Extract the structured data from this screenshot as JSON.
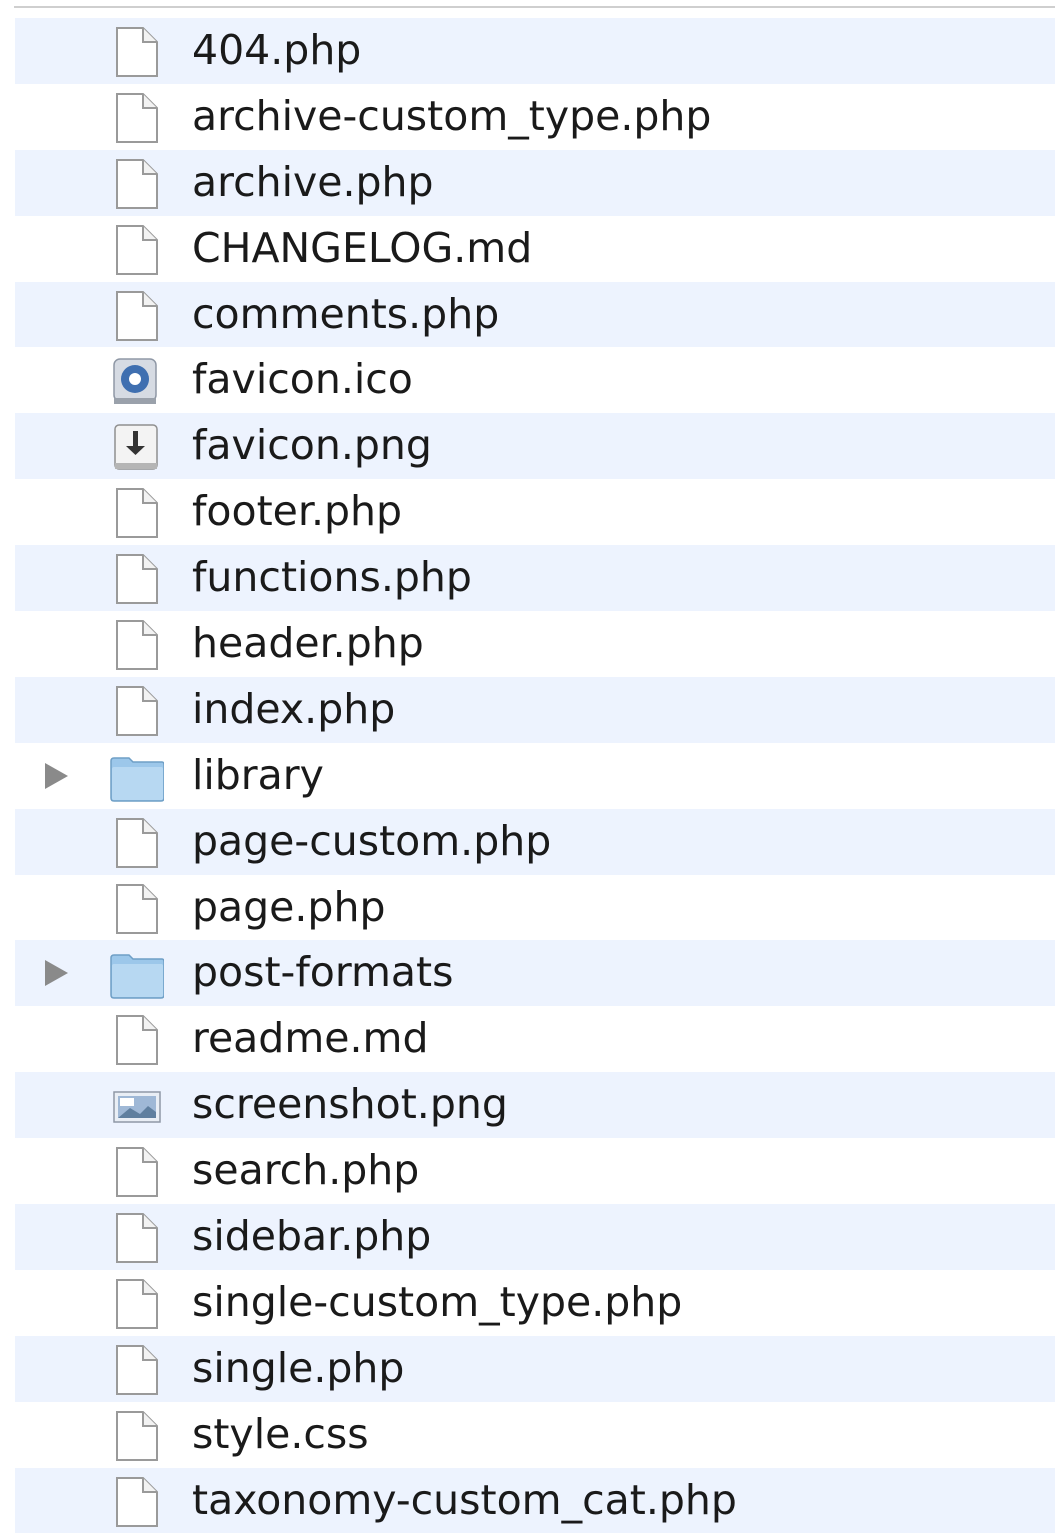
{
  "files": [
    {
      "name": "404.php",
      "icon": "document-icon"
    },
    {
      "name": "archive-custom_type.php",
      "icon": "document-icon"
    },
    {
      "name": "archive.php",
      "icon": "document-icon"
    },
    {
      "name": "CHANGELOG.md",
      "icon": "document-icon"
    },
    {
      "name": "comments.php",
      "icon": "document-icon"
    },
    {
      "name": "favicon.ico",
      "icon": "ico-file-icon"
    },
    {
      "name": "favicon.png",
      "icon": "png-file-icon"
    },
    {
      "name": "footer.php",
      "icon": "document-icon"
    },
    {
      "name": "functions.php",
      "icon": "document-icon"
    },
    {
      "name": "header.php",
      "icon": "document-icon"
    },
    {
      "name": "index.php",
      "icon": "document-icon"
    },
    {
      "name": "library",
      "icon": "folder-icon",
      "folder": true
    },
    {
      "name": "page-custom.php",
      "icon": "document-icon"
    },
    {
      "name": "page.php",
      "icon": "document-icon"
    },
    {
      "name": "post-formats",
      "icon": "folder-icon",
      "folder": true
    },
    {
      "name": "readme.md",
      "icon": "document-icon"
    },
    {
      "name": "screenshot.png",
      "icon": "image-file-icon"
    },
    {
      "name": "search.php",
      "icon": "document-icon"
    },
    {
      "name": "sidebar.php",
      "icon": "document-icon"
    },
    {
      "name": "single-custom_type.php",
      "icon": "document-icon"
    },
    {
      "name": "single.php",
      "icon": "document-icon"
    },
    {
      "name": "style.css",
      "icon": "document-icon"
    },
    {
      "name": "taxonomy-custom_cat.php",
      "icon": "document-icon"
    }
  ],
  "colors": {
    "stripe": "#edf3fe",
    "text": "#1a1a1a",
    "folder": "#9cc7ea",
    "disclosure": "#8a8a8a"
  }
}
